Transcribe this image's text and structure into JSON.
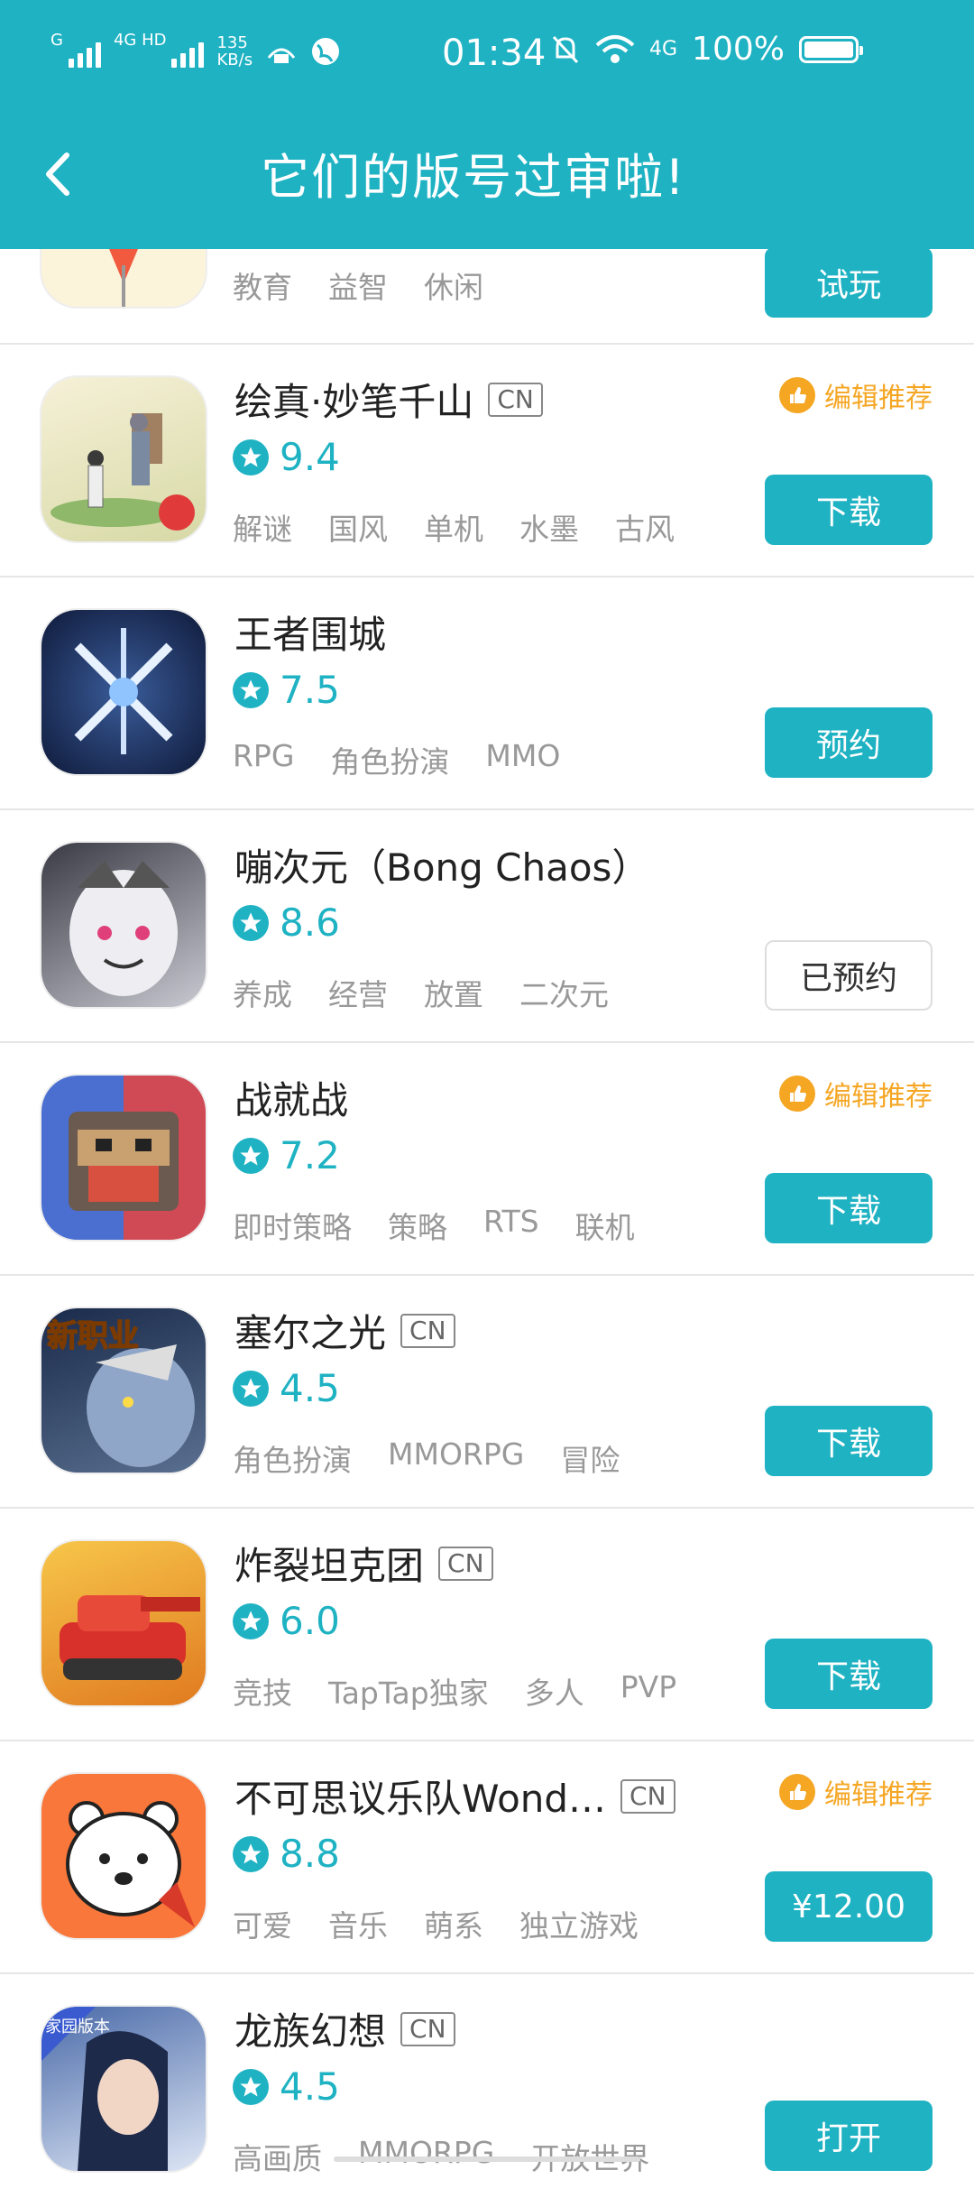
{
  "status_bar": {
    "signal_label": "G",
    "signal2_label": "4G HD",
    "speed_value": "135",
    "speed_unit": "KB/s",
    "time": "01:34",
    "network": "4G",
    "battery": "100%"
  },
  "header": {
    "title": "它们的版号过审啦!"
  },
  "partial_item": {
    "tags": [
      "教育",
      "益智",
      "休闲"
    ],
    "button": "试玩"
  },
  "items": [
    {
      "name": "绘真·妙笔千山",
      "cn": "CN",
      "rating": "9.4",
      "tags": [
        "解谜",
        "国风",
        "单机",
        "水墨",
        "古风"
      ],
      "recommend": "编辑推荐",
      "button": "下载"
    },
    {
      "name": "王者围城",
      "cn": "",
      "rating": "7.5",
      "tags": [
        "RPG",
        "角色扮演",
        "MMO"
      ],
      "recommend": "",
      "button": "预约"
    },
    {
      "name": "嘣次元（Bong Chaos）",
      "cn": "",
      "rating": "8.6",
      "tags": [
        "养成",
        "经营",
        "放置",
        "二次元"
      ],
      "recommend": "",
      "button": "已预约"
    },
    {
      "name": "战就战",
      "cn": "",
      "rating": "7.2",
      "tags": [
        "即时策略",
        "策略",
        "RTS",
        "联机"
      ],
      "recommend": "编辑推荐",
      "button": "下载"
    },
    {
      "name": "塞尔之光",
      "cn": "CN",
      "rating": "4.5",
      "tags": [
        "角色扮演",
        "MMORPG",
        "冒险"
      ],
      "recommend": "",
      "button": "下载"
    },
    {
      "name": "炸裂坦克团",
      "cn": "CN",
      "rating": "6.0",
      "tags": [
        "竞技",
        "TapTap独家",
        "多人",
        "PVP"
      ],
      "recommend": "",
      "button": "下载"
    },
    {
      "name": "不可思议乐队Wond…",
      "cn": "CN",
      "rating": "8.8",
      "tags": [
        "可爱",
        "音乐",
        "萌系",
        "独立游戏"
      ],
      "recommend": "编辑推荐",
      "button": "¥12.00"
    },
    {
      "name": "龙族幻想",
      "cn": "CN",
      "rating": "4.5",
      "tags": [
        "高画质",
        "MMORPG",
        "开放世界"
      ],
      "recommend": "",
      "button": "打开"
    }
  ],
  "icon_text": {
    "sel_badge": "新职业",
    "dragon_badge": "家园版本"
  },
  "colors": {
    "accent": "#1eb2c3",
    "recommend": "#f5a623"
  }
}
